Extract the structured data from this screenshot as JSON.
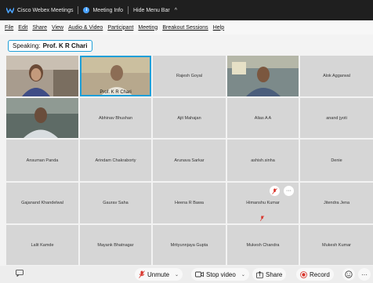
{
  "titlebar": {
    "app_name": "Cisco Webex Meetings",
    "meeting_info": "Meeting Info",
    "hide_menu_bar": "Hide Menu Bar"
  },
  "menu": [
    "File",
    "Edit",
    "Share",
    "View",
    "Audio & Video",
    "Participant",
    "Meeting",
    "Breakout Sessions",
    "Help"
  ],
  "speaking": {
    "label": "Speaking:",
    "name": "Prof. K R Chari"
  },
  "participants": [
    {
      "name": "",
      "video": true
    },
    {
      "name": "Prof. K R Chari",
      "video": true,
      "active": true
    },
    {
      "name": "Rajesh Goyal"
    },
    {
      "name": "",
      "video": true
    },
    {
      "name": "Alok Aggarwal"
    },
    {
      "name": "",
      "video": true
    },
    {
      "name": "Abhinav Bhushan"
    },
    {
      "name": "Ajit Mahajan"
    },
    {
      "name": "Alias A A"
    },
    {
      "name": "anand jyoti"
    },
    {
      "name": "Ansuman Panda"
    },
    {
      "name": "Arindam Chakraborty"
    },
    {
      "name": "Arunava Sarkar"
    },
    {
      "name": "ashish.sinha"
    },
    {
      "name": "Denie"
    },
    {
      "name": "Gajanand Khandelwal"
    },
    {
      "name": "Gaurav Saha"
    },
    {
      "name": "Heena R Bawa"
    },
    {
      "name": "Himanshu Kumar"
    },
    {
      "name": "Jitendra Jena"
    },
    {
      "name": "Lalit Kamde"
    },
    {
      "name": "Mayank Bhatnagar"
    },
    {
      "name": "Mrityunnjaya Gupta"
    },
    {
      "name": "Mukesh Chandra"
    },
    {
      "name": "Mukesh Kumar"
    }
  ],
  "controls": {
    "unmute": "Unmute",
    "stop_video": "Stop video",
    "share": "Share",
    "record": "Record"
  },
  "colors": {
    "accent": "#1e9fd8",
    "muted_red": "#d9342b",
    "record_red": "#d9342b"
  }
}
